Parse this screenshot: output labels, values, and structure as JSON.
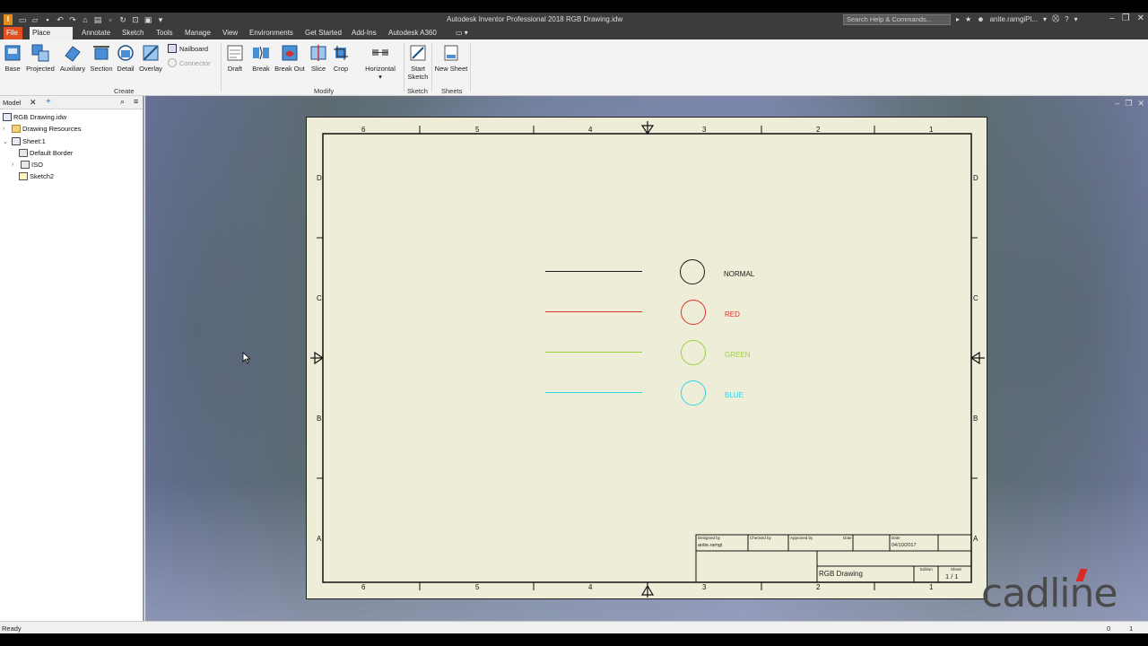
{
  "title_bar": {
    "app_title": "Autodesk Inventor Professional 2018   RGB Drawing.idw",
    "search_placeholder": "Search Help & Commands...",
    "user": "anite.ramgiPl...",
    "logo": "I"
  },
  "tabs": [
    {
      "label": "File"
    },
    {
      "label": "Place Views"
    },
    {
      "label": "Annotate"
    },
    {
      "label": "Sketch"
    },
    {
      "label": "Tools"
    },
    {
      "label": "Manage"
    },
    {
      "label": "View"
    },
    {
      "label": "Environments"
    },
    {
      "label": "Get Started"
    },
    {
      "label": "Add-Ins"
    },
    {
      "label": "Autodesk A360"
    }
  ],
  "ribbon": {
    "create": {
      "label": "Create",
      "buttons": [
        "Base",
        "Projected",
        "Auxiliary",
        "Section",
        "Detail",
        "Overlay"
      ],
      "nailboard": "Nailboard",
      "connector": "Connector"
    },
    "modify": {
      "label": "Modify",
      "buttons": [
        "Draft",
        "Break",
        "Break Out",
        "Slice",
        "Crop",
        "Horizontal"
      ]
    },
    "sketch": {
      "label": "Sketch",
      "start_line1": "Start",
      "start_line2": "Sketch"
    },
    "sheets": {
      "label": "Sheets",
      "new_sheet": "New Sheet"
    }
  },
  "browser": {
    "tab_label": "Model",
    "items": [
      {
        "label": "RGB Drawing.idw"
      },
      {
        "label": "Drawing Resources"
      },
      {
        "label": "Sheet:1"
      },
      {
        "label": "Default Border"
      },
      {
        "label": "ISO"
      },
      {
        "label": "Sketch2"
      }
    ]
  },
  "drawing": {
    "column_labels": [
      "6",
      "5",
      "4",
      "3",
      "2",
      "1"
    ],
    "row_labels": [
      "D",
      "C",
      "B",
      "A"
    ],
    "samples": [
      {
        "label": "NORMAL",
        "color": "#1a1a1a"
      },
      {
        "label": "RED",
        "color": "#e0332b"
      },
      {
        "label": "GREEN",
        "color": "#9ccf3a"
      },
      {
        "label": "BLUE",
        "color": "#33d6e6"
      }
    ],
    "title_block": {
      "designed_by_label": "Designed by",
      "designed_by": "anite.ramgi",
      "checked_by_label": "Checked by",
      "approved_by_label": "Approved by",
      "date_label": "Date",
      "date_label2": "Date",
      "date": "04/10/2017",
      "title": "RGB Drawing",
      "edition_label": "Edition",
      "sheet_label": "Sheet",
      "sheet": "1 / 1"
    }
  },
  "status": {
    "text": "Ready",
    "count1": "0",
    "count2": "1"
  },
  "watermark": "cadline"
}
